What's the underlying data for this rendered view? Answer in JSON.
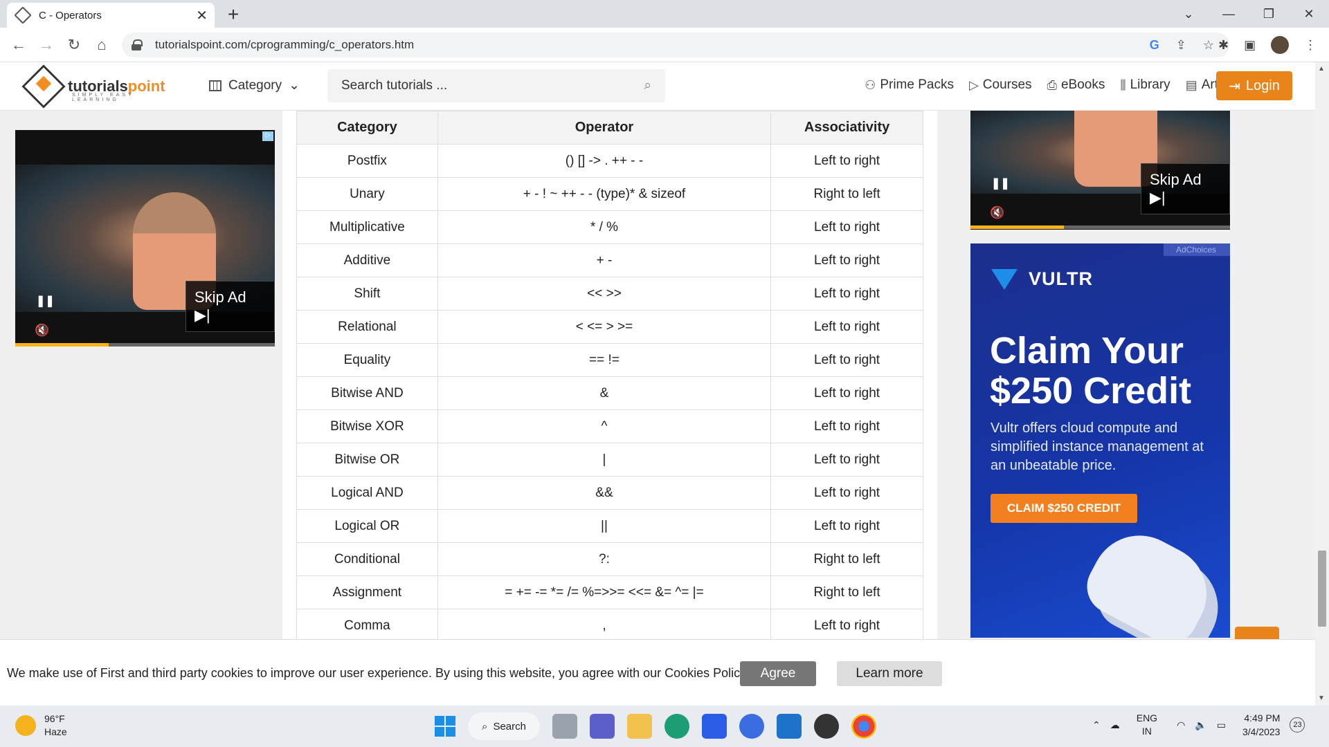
{
  "browser": {
    "tab_title": "C - Operators",
    "tab_close": "✕",
    "new_tab": "+",
    "url": "tutorialspoint.com/cprogramming/c_operators.htm",
    "win_controls": [
      "⌄",
      "—",
      "❐",
      "✕"
    ]
  },
  "site": {
    "brand_prefix": "tutorials",
    "brand_suffix": "point",
    "tagline": "SIMPLY EASY LEARNING",
    "category_label": "Category",
    "search_placeholder": "Search tutorials ...",
    "nav": [
      {
        "icon": "prime-packs-icon",
        "label": "Prime Packs"
      },
      {
        "icon": "courses-icon",
        "label": "Courses"
      },
      {
        "icon": "ebooks-icon",
        "label": "eBooks"
      },
      {
        "icon": "library-icon",
        "label": "Library"
      },
      {
        "icon": "articles-icon",
        "label": "Articles"
      }
    ],
    "login_label": "Login",
    "accent": "#e8841a"
  },
  "ads": {
    "left_video": {
      "skip_label": "Skip Ad",
      "progress": 0.36
    },
    "right_video": {
      "skip_label": "Skip Ad",
      "progress": 0.36
    },
    "vultr": {
      "adchoices": "AdChoices",
      "brand": "VULTR",
      "headline": "Claim Your $250 Credit",
      "body": "Vultr offers cloud compute and simplified instance management at an unbeatable price.",
      "cta": "CLAIM $250 CREDIT"
    }
  },
  "table": {
    "headers": [
      "Category",
      "Operator",
      "Associativity"
    ],
    "rows": [
      [
        "Postfix",
        "() [] -> . ++ - -",
        "Left to right"
      ],
      [
        "Unary",
        "+ - ! ~ ++ - - (type)* & sizeof",
        "Right to left"
      ],
      [
        "Multiplicative",
        "* / %",
        "Left to right"
      ],
      [
        "Additive",
        "+ -",
        "Left to right"
      ],
      [
        "Shift",
        "<< >>",
        "Left to right"
      ],
      [
        "Relational",
        "< <= > >=",
        "Left to right"
      ],
      [
        "Equality",
        "== !=",
        "Left to right"
      ],
      [
        "Bitwise AND",
        "&",
        "Left to right"
      ],
      [
        "Bitwise XOR",
        "^",
        "Left to right"
      ],
      [
        "Bitwise OR",
        "|",
        "Left to right"
      ],
      [
        "Logical AND",
        "&&",
        "Left to right"
      ],
      [
        "Logical OR",
        "||",
        "Left to right"
      ],
      [
        "Conditional",
        "?:",
        "Right to left"
      ],
      [
        "Assignment",
        "= += -= *= /= %=>>= <<= &= ^= |=",
        "Right to left"
      ],
      [
        "Comma",
        ",",
        "Left to right"
      ]
    ]
  },
  "cookie": {
    "message": "We make use of First and third party cookies to improve our user experience. By using this website, you agree with our Cookies Policy.",
    "agree": "Agree",
    "learn_more": "Learn more"
  },
  "taskbar": {
    "temperature": "96°F",
    "condition": "Haze",
    "search_label": "Search",
    "lang_top": "ENG",
    "lang_bottom": "IN",
    "time": "4:49 PM",
    "date": "3/4/2023",
    "notifications": "23"
  }
}
